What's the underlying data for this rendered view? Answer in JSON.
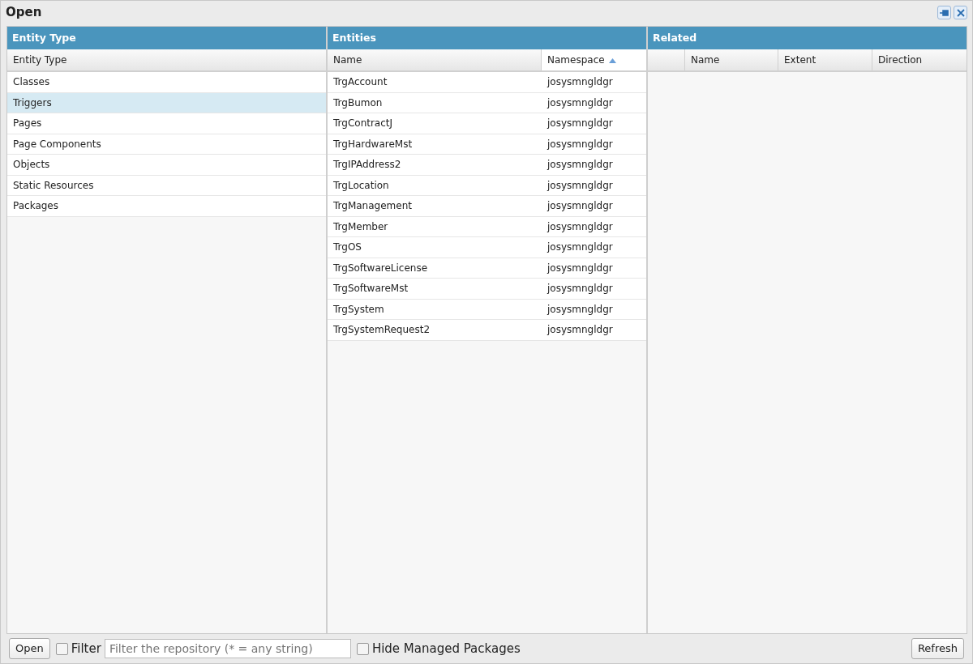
{
  "window": {
    "title": "Open"
  },
  "entity_type_panel": {
    "title": "Entity Type",
    "columns": [
      {
        "label": "Entity Type"
      }
    ],
    "items": [
      {
        "label": "Classes",
        "selected": false
      },
      {
        "label": "Triggers",
        "selected": true
      },
      {
        "label": "Pages",
        "selected": false
      },
      {
        "label": "Page Components",
        "selected": false
      },
      {
        "label": "Objects",
        "selected": false
      },
      {
        "label": "Static Resources",
        "selected": false
      },
      {
        "label": "Packages",
        "selected": false
      }
    ]
  },
  "entities_panel": {
    "title": "Entities",
    "columns": [
      {
        "label": "Name",
        "sorted": false
      },
      {
        "label": "Namespace",
        "sorted": true
      }
    ],
    "rows": [
      [
        "TrgAccount",
        "josysmngldgr"
      ],
      [
        "TrgBumon",
        "josysmngldgr"
      ],
      [
        "TrgContractJ",
        "josysmngldgr"
      ],
      [
        "TrgHardwareMst",
        "josysmngldgr"
      ],
      [
        "TrgIPAddress2",
        "josysmngldgr"
      ],
      [
        "TrgLocation",
        "josysmngldgr"
      ],
      [
        "TrgManagement",
        "josysmngldgr"
      ],
      [
        "TrgMember",
        "josysmngldgr"
      ],
      [
        "TrgOS",
        "josysmngldgr"
      ],
      [
        "TrgSoftwareLicense",
        "josysmngldgr"
      ],
      [
        "TrgSoftwareMst",
        "josysmngldgr"
      ],
      [
        "TrgSystem",
        "josysmngldgr"
      ],
      [
        "TrgSystemRequest2",
        "josysmngldgr"
      ]
    ]
  },
  "related_panel": {
    "title": "Related",
    "columns": [
      {
        "label": "Name"
      },
      {
        "label": "Extent"
      },
      {
        "label": "Direction"
      }
    ]
  },
  "footer": {
    "open_button": "Open",
    "filter_checkbox": {
      "label": "Filter",
      "checked": false
    },
    "filter_field": {
      "placeholder": "Filter the repository (* = any string)"
    },
    "hide_managed_checkbox": {
      "label": "Hide Managed Packages",
      "checked": false
    },
    "refresh_button": "Refresh"
  }
}
